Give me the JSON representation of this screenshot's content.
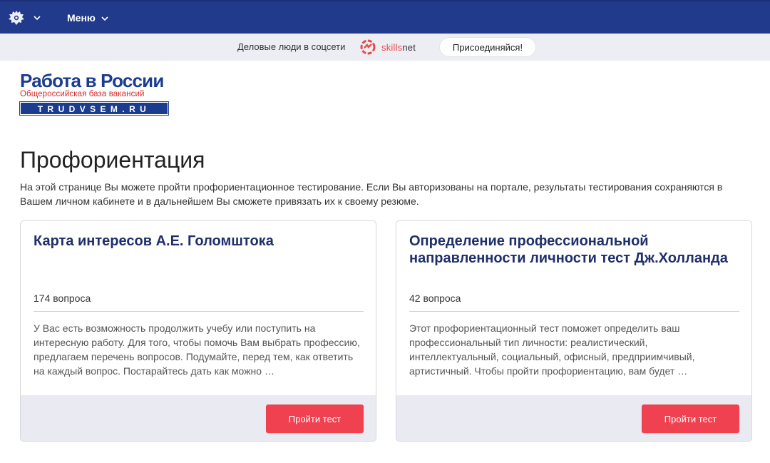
{
  "nav": {
    "menu_label": "Меню"
  },
  "promo": {
    "text": "Деловые люди в соцсети",
    "brand_left": "skills",
    "brand_right": "net",
    "join_label": "Присоединяйся!"
  },
  "logo": {
    "title": "Работа в России",
    "subtitle": "Общероссийская база вакансий",
    "domain": "TRUDVSEM.RU"
  },
  "page": {
    "title": "Профориентация",
    "description": "На этой странице Вы можете пройти профориентационное тестирование. Если Вы авторизованы на портале, результаты тестирования сохраняются в Вашем личном кабинете и в дальнейшем Вы сможете привязать их к своему резюме."
  },
  "cards": [
    {
      "title": "Карта интересов А.Е. Голомштока",
      "count": "174 вопроса",
      "description": "У Вас есть возможность продолжить учебу или поступить на интересную работу. Для того, чтобы помочь Вам выбрать профессию, предлагаем перечень вопросов. Подумайте, перед тем, как ответить на каждый вопрос. Постарайтесь дать как можно …",
      "button_label": "Пройти тест"
    },
    {
      "title": "Определение профессиональной направленности личности тест Дж.Холланда",
      "count": "42 вопроса",
      "description": "Этот профориентационный тест поможет определить ваш профессиональный тип личности: реалистический, интеллектуальный, социальный, офисный, предприимчивый, артистичный. Чтобы пройти профориентацию, вам будет …",
      "button_label": "Пройти тест"
    }
  ],
  "colors": {
    "nav_bg": "#223a8c",
    "accent_red": "#ef4150",
    "brand_blue": "#1b3c8f",
    "footer_bg": "#eaebf2"
  }
}
